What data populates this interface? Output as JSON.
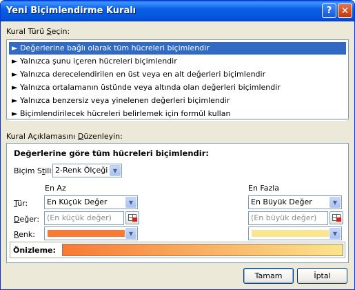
{
  "window": {
    "title": "Yeni Biçimlendirme Kuralı",
    "help_label": "?",
    "close_label": "✕"
  },
  "rule_type": {
    "label_pre": "Kural Türü ",
    "label_u": "S",
    "label_post": "eçin:",
    "items": [
      {
        "label": "► Değerlerine bağlı olarak tüm hücreleri biçimlendir",
        "selected": true
      },
      {
        "label": "► Yalnızca şunu içeren hücreleri biçimlendir",
        "selected": false
      },
      {
        "label": "► Yalnızca derecelendirilen en üst veya en alt değerleri biçimlendir",
        "selected": false
      },
      {
        "label": "► Yalnızca ortalamanın üstünde veya altında olan değerleri biçimlendir",
        "selected": false
      },
      {
        "label": "► Yalnızca benzersiz veya yinelenen değerleri biçimlendir",
        "selected": false
      },
      {
        "label": "► Biçimlendirilecek hücreleri belirlemek için formül kullan",
        "selected": false
      }
    ]
  },
  "description": {
    "label_pre": "Kural Açıklamasını ",
    "label_u": "D",
    "label_post": "üzenleyin:",
    "heading": "Değerlerine göre tüm hücreleri biçimlendir:",
    "format_style": {
      "label_pre": "Biçim S",
      "label_u": "t",
      "label_post": "ili:",
      "value": "2-Renk Ölçeği"
    },
    "min_header": "En Az",
    "max_header": "En Fazla",
    "type_label_u": "T",
    "type_label_post": "ür:",
    "value_label_u": "D",
    "value_label_post": "eğer:",
    "color_label_u": "R",
    "color_label_post": "enk:",
    "min_type": "En Küçük Değer",
    "max_type": "En Büyük Değer",
    "min_value_placeholder": "(En küçük değer)",
    "max_value_placeholder": "(En büyük değer)",
    "min_color": "#f87a34",
    "max_color": "#fbe58e",
    "preview_label": "Önizleme:"
  },
  "buttons": {
    "ok": "Tamam",
    "cancel": "İptal"
  }
}
